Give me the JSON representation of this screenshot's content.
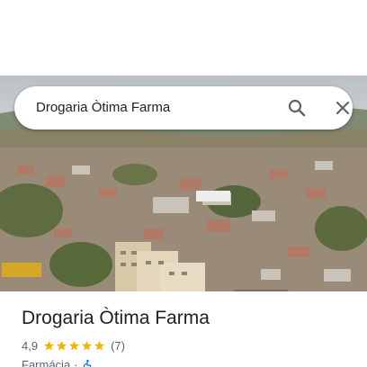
{
  "search": {
    "query": "Drogaria Òtima Farma",
    "search_icon": "search-icon",
    "close_icon": "close-icon"
  },
  "place": {
    "name": "Drogaria Òtima Farma",
    "rating": "4,9",
    "stars_filled": 5,
    "stars_total": 5,
    "review_count": "(7)",
    "category": "Farmácia",
    "separator": "·",
    "accessibility_icon": "wheelchair-icon"
  },
  "colors": {
    "star": "#f4b400",
    "accessibility": "#1a73e8",
    "text_primary": "#202124",
    "text_secondary": "#5f6368"
  }
}
